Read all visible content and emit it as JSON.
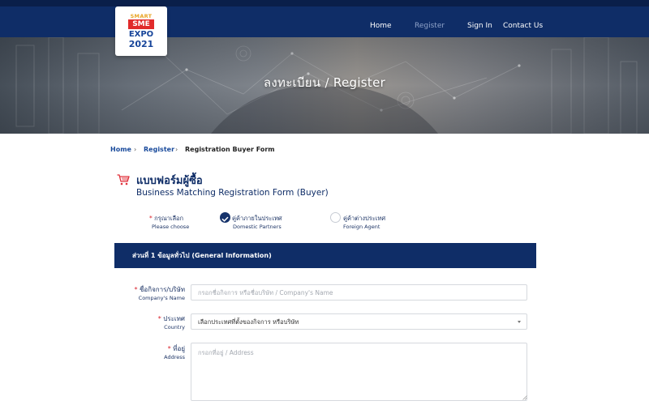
{
  "logo": {
    "line1": "SMART",
    "line2": "SME",
    "line3": "EXPO",
    "line4": "2021"
  },
  "nav": {
    "items": [
      "Home",
      "Register",
      "Sign In",
      "Contact Us"
    ],
    "active": "Register"
  },
  "hero": {
    "title": "ลงทะเบียน / Register"
  },
  "breadcrumb": {
    "home": "Home",
    "register": "Register",
    "current": "Registration Buyer Form",
    "separator": "›"
  },
  "form_header": {
    "title_th": "แบบฟอร์มผู้ซื้อ",
    "title_en": "Business Matching Registration Form (Buyer)",
    "icon": "cart-icon"
  },
  "buyer_type": {
    "required_mark": "*",
    "prompt_th": "กรุณาเลือก",
    "prompt_en": "Please choose",
    "options": [
      {
        "label_th": "คู่ค้าภายในประเทศ",
        "label_en": "Domestic Partners",
        "selected": true
      },
      {
        "label_th": "คู่ค้าต่างประเทศ",
        "label_en": "Foreign Agent",
        "selected": false
      }
    ]
  },
  "section": {
    "title": "ส่วนที่ 1 ข้อมูลทั่วไป (General Information)"
  },
  "fields": {
    "company": {
      "label_th": "ชื่อกิจการ/บริษัท",
      "label_en": "Company's Name",
      "placeholder": "กรอกชื่อกิจการ หรือชื่อบริษัท / Company's Name",
      "value": ""
    },
    "country": {
      "label_th": "ประเทศ",
      "label_en": "Country",
      "selected": "เลือกประเทศที่ตั้งของกิจการ หรือบริษัท"
    },
    "address": {
      "label_th": "ที่อยู่",
      "label_en": "Address",
      "placeholder": "กรอกที่อยู่ / Address",
      "value": ""
    }
  },
  "colors": {
    "navy": "#0f2d67",
    "required": "#d9232d",
    "link": "#1a4b9c"
  }
}
